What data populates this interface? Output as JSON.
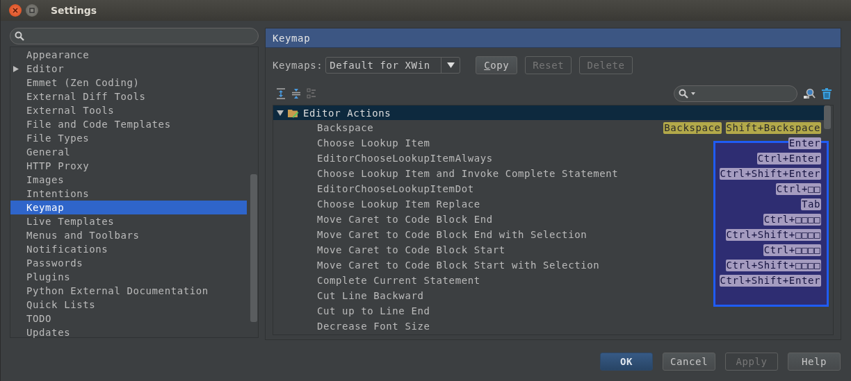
{
  "window": {
    "title": "Settings"
  },
  "sidebar": {
    "items": [
      {
        "label": "Appearance",
        "expandable": false,
        "selected": false
      },
      {
        "label": "Editor",
        "expandable": true,
        "selected": false
      },
      {
        "label": "Emmet (Zen Coding)",
        "expandable": false,
        "selected": false
      },
      {
        "label": "External Diff Tools",
        "expandable": false,
        "selected": false
      },
      {
        "label": "External Tools",
        "expandable": false,
        "selected": false
      },
      {
        "label": "File and Code Templates",
        "expandable": false,
        "selected": false
      },
      {
        "label": "File Types",
        "expandable": false,
        "selected": false
      },
      {
        "label": "General",
        "expandable": false,
        "selected": false
      },
      {
        "label": "HTTP Proxy",
        "expandable": false,
        "selected": false
      },
      {
        "label": "Images",
        "expandable": false,
        "selected": false
      },
      {
        "label": "Intentions",
        "expandable": false,
        "selected": false
      },
      {
        "label": "Keymap",
        "expandable": false,
        "selected": true
      },
      {
        "label": "Live Templates",
        "expandable": false,
        "selected": false
      },
      {
        "label": "Menus and Toolbars",
        "expandable": false,
        "selected": false
      },
      {
        "label": "Notifications",
        "expandable": false,
        "selected": false
      },
      {
        "label": "Passwords",
        "expandable": false,
        "selected": false
      },
      {
        "label": "Plugins",
        "expandable": false,
        "selected": false
      },
      {
        "label": "Python External Documentation",
        "expandable": false,
        "selected": false
      },
      {
        "label": "Quick Lists",
        "expandable": false,
        "selected": false
      },
      {
        "label": "TODO",
        "expandable": false,
        "selected": false
      },
      {
        "label": "Updates",
        "expandable": false,
        "selected": false
      }
    ]
  },
  "panel": {
    "title": "Keymap",
    "keymaps_label": "Keymaps:",
    "keymap_value": "Default for XWin",
    "buttons": [
      {
        "label": "Copy",
        "mnemonic": true,
        "disabled": false
      },
      {
        "label": "Reset",
        "mnemonic": false,
        "disabled": true
      },
      {
        "label": "Delete",
        "mnemonic": false,
        "disabled": true
      }
    ],
    "tree": {
      "group": {
        "label": "Editor Actions",
        "expanded": true
      },
      "highlight_box": true,
      "actions": [
        {
          "label": "Backspace",
          "shortcuts": [
            {
              "label": "Backspace",
              "matched": true
            },
            {
              "label": "Shift+Backspace",
              "matched": true
            }
          ]
        },
        {
          "label": "Choose Lookup Item",
          "shortcuts": [
            {
              "label": "Enter",
              "matched": false
            }
          ]
        },
        {
          "label": "EditorChooseLookupItemAlways",
          "shortcuts": [
            {
              "label": "Ctrl+Enter",
              "matched": false
            }
          ]
        },
        {
          "label": "Choose Lookup Item and Invoke Complete Statement",
          "shortcuts": [
            {
              "label": "Ctrl+Shift+Enter",
              "matched": false
            }
          ]
        },
        {
          "label": "EditorChooseLookupItemDot",
          "shortcuts": [
            {
              "label": "Ctrl+□□",
              "matched": false
            }
          ]
        },
        {
          "label": "Choose Lookup Item Replace",
          "shortcuts": [
            {
              "label": "Tab",
              "matched": false
            }
          ]
        },
        {
          "label": "Move Caret to Code Block End",
          "shortcuts": [
            {
              "label": "Ctrl+□□□□",
              "matched": false
            }
          ]
        },
        {
          "label": "Move Caret to Code Block End with Selection",
          "shortcuts": [
            {
              "label": "Ctrl+Shift+□□□□",
              "matched": false
            }
          ]
        },
        {
          "label": "Move Caret to Code Block Start",
          "shortcuts": [
            {
              "label": "Ctrl+□□□□",
              "matched": false
            }
          ]
        },
        {
          "label": "Move Caret to Code Block Start with Selection",
          "shortcuts": [
            {
              "label": "Ctrl+Shift+□□□□",
              "matched": false
            }
          ]
        },
        {
          "label": "Complete Current Statement",
          "shortcuts": [
            {
              "label": "Ctrl+Shift+Enter",
              "matched": false
            }
          ]
        },
        {
          "label": "Cut Line Backward"
        },
        {
          "label": "Cut up to Line End"
        },
        {
          "label": "Decrease Font Size"
        }
      ]
    }
  },
  "footer": {
    "buttons": [
      {
        "label": "OK",
        "kind": "default",
        "disabled": false
      },
      {
        "label": "Cancel",
        "kind": "normal",
        "disabled": false
      },
      {
        "label": "Apply",
        "kind": "normal",
        "disabled": true
      },
      {
        "label": "Help",
        "kind": "normal",
        "disabled": false
      }
    ]
  }
}
